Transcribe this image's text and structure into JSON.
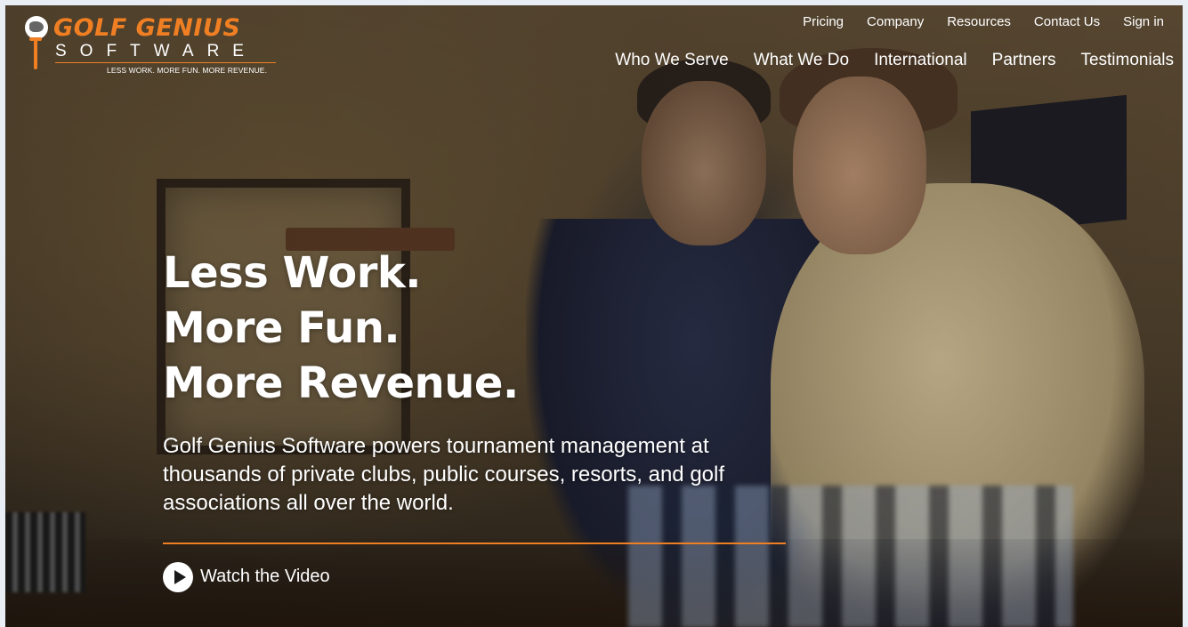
{
  "logo": {
    "brand": "GOLF GENIUS",
    "sub": "SOFTWARE",
    "tagline": "LESS WORK. MORE FUN. MORE REVENUE."
  },
  "topnav": [
    "Pricing",
    "Company",
    "Resources",
    "Contact Us",
    "Sign in"
  ],
  "mainnav": [
    "Who We Serve",
    "What We Do",
    "International",
    "Partners",
    "Testimonials"
  ],
  "hero": {
    "headline": [
      "Less Work.",
      "More Fun.",
      "More Revenue."
    ],
    "description": "Golf Genius Software powers tournament management at thousands of private clubs, public courses, resorts, and golf associations all over the world.",
    "cta": "Watch the Video"
  },
  "colors": {
    "accent": "#f07f23",
    "text": "#ffffff"
  },
  "icons": {
    "logo": "golf-ball-on-tee-icon",
    "cta": "play-circle-icon"
  }
}
